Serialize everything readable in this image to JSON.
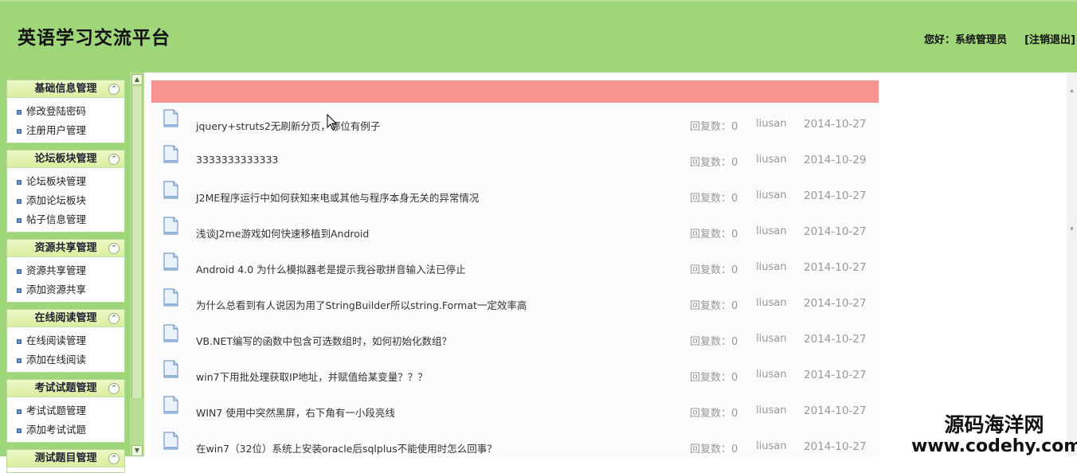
{
  "header": {
    "site_title": "英语学习交流平台",
    "greeting": "您好：系统管理员",
    "logout_label": "[注销退出]"
  },
  "sidebar": {
    "panels": [
      {
        "title": "基础信息管理",
        "items": [
          "修改登陆密码",
          "注册用户管理"
        ]
      },
      {
        "title": "论坛板块管理",
        "items": [
          "论坛板块管理",
          "添加论坛板块",
          "帖子信息管理"
        ]
      },
      {
        "title": "资源共享管理",
        "items": [
          "资源共享管理",
          "添加资源共享"
        ]
      },
      {
        "title": "在线阅读管理",
        "items": [
          "在线阅读管理",
          "添加在线阅读"
        ]
      },
      {
        "title": "考试试题管理",
        "items": [
          "考试试题管理",
          "添加考试试题"
        ]
      },
      {
        "title": "测试题目管理",
        "items": []
      }
    ],
    "collapse_glyph": "⌃"
  },
  "posts": [
    {
      "title": "jquery+struts2无刷新分页，哪位有例子",
      "replies": "回复数：0",
      "author": "liusan",
      "date": "2014-10-27"
    },
    {
      "title": "3333333333333",
      "replies": "回复数：0",
      "author": "liusan",
      "date": "2014-10-29"
    },
    {
      "title": "J2ME程序运行中如何获知来电或其他与程序本身无关的异常情况",
      "replies": "回复数：0",
      "author": "liusan",
      "date": "2014-10-27"
    },
    {
      "title": "浅谈J2me游戏如何快速移植到Android",
      "replies": "回复数：0",
      "author": "liusan",
      "date": "2014-10-27"
    },
    {
      "title": "Android 4.0 为什么模拟器老是提示我谷歌拼音输入法已停止",
      "replies": "回复数：0",
      "author": "liusan",
      "date": "2014-10-27"
    },
    {
      "title": "为什么总看到有人说因为用了StringBuilder所以string.Format一定效率高",
      "replies": "回复数：0",
      "author": "liusan",
      "date": "2014-10-27"
    },
    {
      "title": "VB.NET编写的函数中包含可选数组时，如何初始化数组？",
      "replies": "回复数：0",
      "author": "liusan",
      "date": "2014-10-27"
    },
    {
      "title": "win7下用批处理获取IP地址，并赋值给某变量？？？",
      "replies": "回复数：0",
      "author": "liusan",
      "date": "2014-10-27"
    },
    {
      "title": "WIN7 使用中突然黑屏，右下角有一小段亮线",
      "replies": "回复数：0",
      "author": "liusan",
      "date": "2014-10-27"
    },
    {
      "title": "在win7（32位）系统上安装oracle后sqlplus不能使用时怎么回事？",
      "replies": "回复数：0",
      "author": "liusan",
      "date": "2014-10-27"
    }
  ],
  "watermark": {
    "name": "源码海洋网",
    "url": "www.codehy.com"
  },
  "colors": {
    "header_bg": "#9fd67a",
    "pink_bar": "#f7948f",
    "meta_text": "#999999"
  },
  "icons": {
    "post": "document-icon",
    "collapse": "collapse-icon"
  }
}
